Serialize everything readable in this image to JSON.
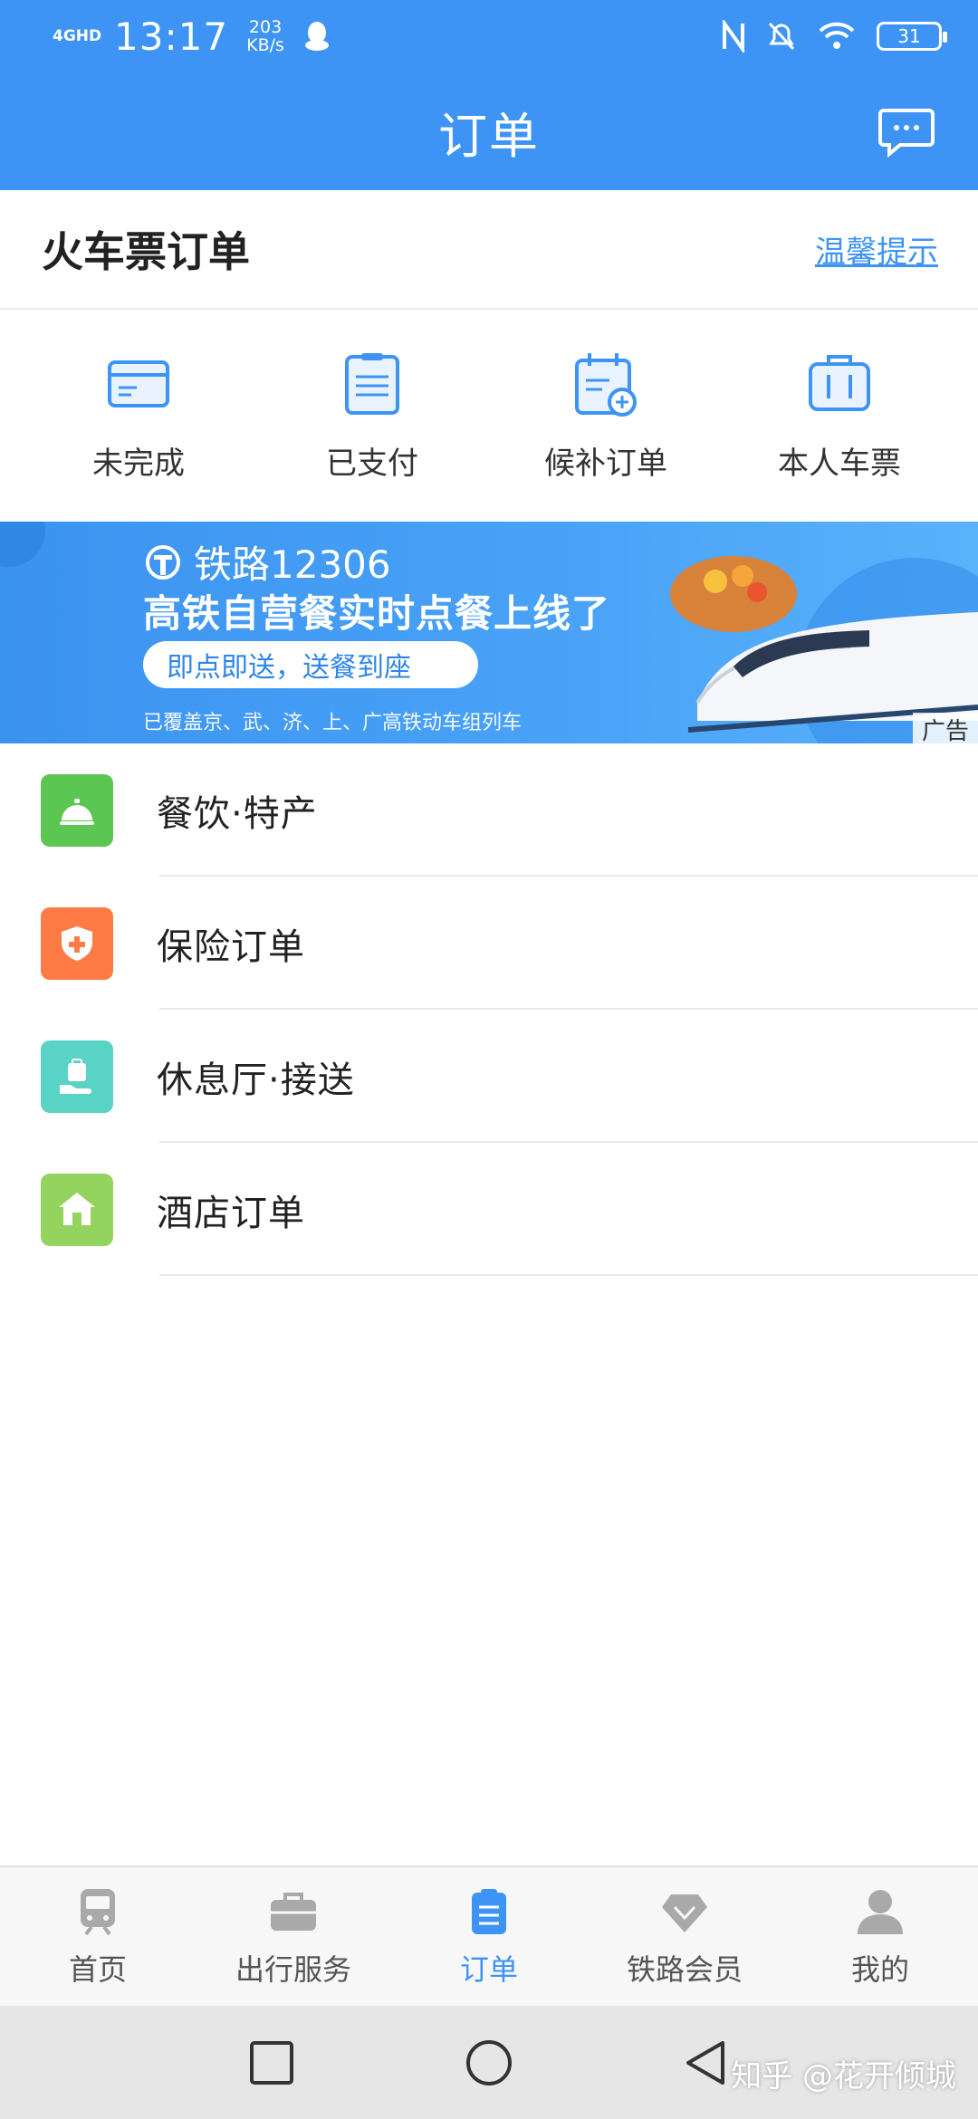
{
  "status_bar": {
    "network": "4GHD",
    "time": "13:17",
    "speed": "203\nKB/s",
    "battery": "31"
  },
  "header": {
    "title": "订单"
  },
  "section": {
    "title": "火车票订单",
    "tip": "温馨提示"
  },
  "quick_actions": [
    {
      "label": "未完成",
      "icon": "card-icon"
    },
    {
      "label": "已支付",
      "icon": "document-icon"
    },
    {
      "label": "候补订单",
      "icon": "calendar-plus-icon"
    },
    {
      "label": "本人车票",
      "icon": "suitcase-icon"
    }
  ],
  "banner": {
    "brand": "铁路12306",
    "headline": "高铁自营餐实时点餐上线了",
    "pill": "即点即送，送餐到座",
    "footer": "已覆盖京、武、济、上、广高铁动车组列车",
    "ad_tag": "广告"
  },
  "list": [
    {
      "label": "餐饮·特产",
      "icon": "service-bell-icon",
      "color": "#57c84f"
    },
    {
      "label": "保险订单",
      "icon": "shield-plus-icon",
      "color": "#ff7a43"
    },
    {
      "label": "休息厅·接送",
      "icon": "hand-luggage-icon",
      "color": "#4fd1c5"
    },
    {
      "label": "酒店订单",
      "icon": "house-icon",
      "color": "#8fd15a"
    }
  ],
  "tabbar": [
    {
      "label": "首页",
      "icon": "train-icon",
      "active": false
    },
    {
      "label": "出行服务",
      "icon": "briefcase-icon",
      "active": false
    },
    {
      "label": "订单",
      "icon": "order-clipboard-icon",
      "active": true
    },
    {
      "label": "铁路会员",
      "icon": "diamond-icon",
      "active": false
    },
    {
      "label": "我的",
      "icon": "user-icon",
      "active": false
    }
  ],
  "watermark": "知乎 @花开倾城",
  "colors": {
    "primary": "#3d94f5",
    "tab_inactive": "#a9a9a9"
  }
}
